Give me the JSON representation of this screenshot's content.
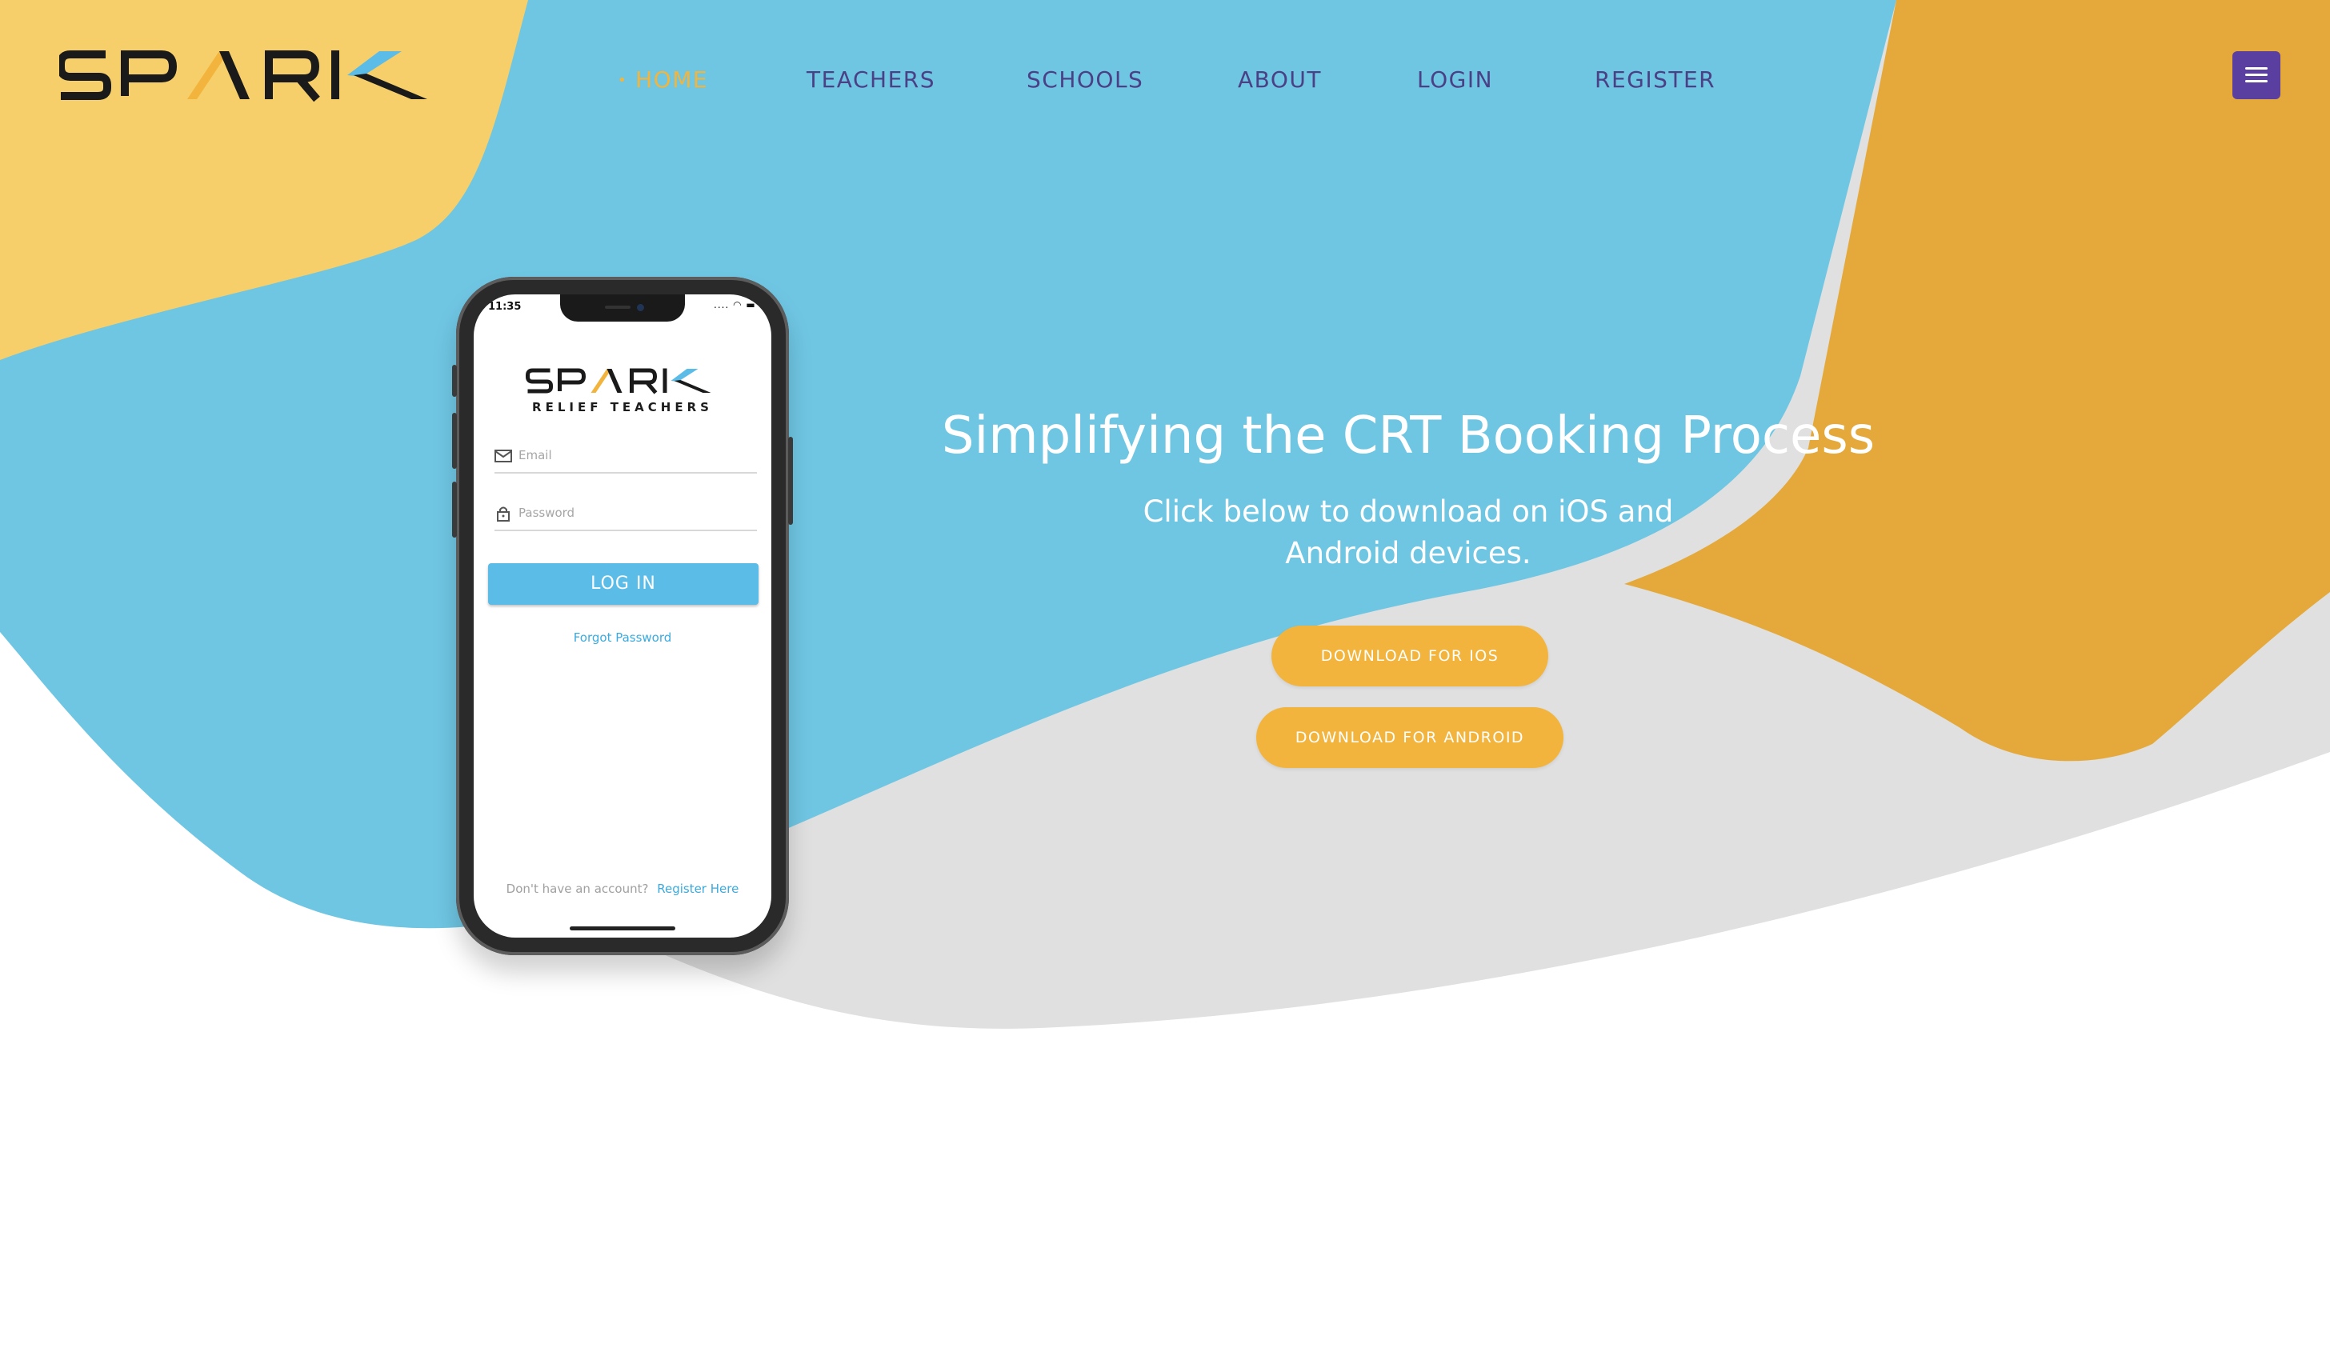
{
  "brand": {
    "name": "SPARK",
    "colors": {
      "blue": "#6fc6e3",
      "yellow": "#f6cf6a",
      "orange": "#e4a93a",
      "gray": "#e0e0e0",
      "purple": "#4b3f86",
      "accent": "#f2b43c"
    }
  },
  "nav": {
    "items": [
      {
        "label": "HOME",
        "active": true
      },
      {
        "label": "TEACHERS",
        "active": false
      },
      {
        "label": "SCHOOLS",
        "active": false
      },
      {
        "label": "ABOUT",
        "active": false
      },
      {
        "label": "LOGIN",
        "active": false
      },
      {
        "label": "REGISTER",
        "active": false
      }
    ],
    "active_marker": "•",
    "menu_icon": "hamburger-icon"
  },
  "phone": {
    "status_time": "11:35",
    "status_icons": "....",
    "app_name": "SPARK",
    "app_subtitle": "RELIEF TEACHERS",
    "email_placeholder": "Email",
    "password_placeholder": "Password",
    "login_label": "LOG IN",
    "forgot_label": "Forgot Password",
    "no_account_text": "Don't have an account?",
    "register_link": "Register Here"
  },
  "hero": {
    "title": "Simplifying the CRT Booking Process",
    "subtitle_line1": "Click below to download on iOS and",
    "subtitle_line2": "Android devices.",
    "ios_button": "DOWNLOAD FOR IOS",
    "android_button": "DOWNLOAD FOR ANDROID"
  }
}
